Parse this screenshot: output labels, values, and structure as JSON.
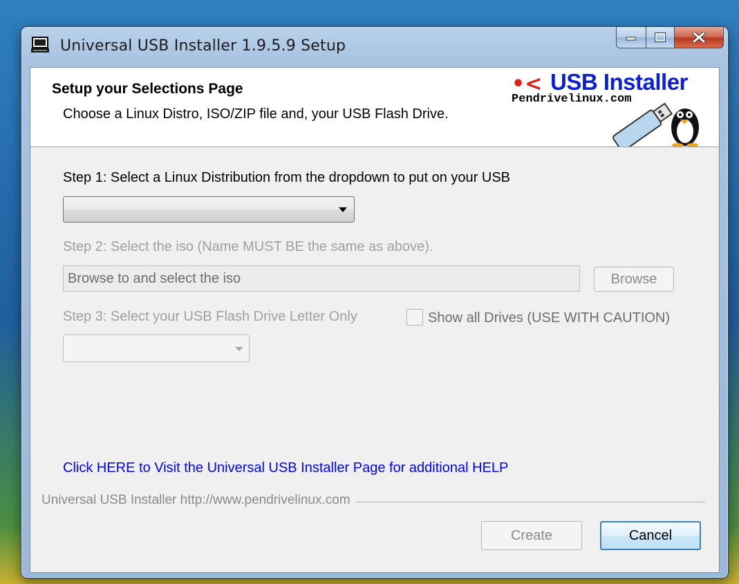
{
  "window": {
    "title": "Universal USB Installer 1.9.5.9 Setup"
  },
  "header": {
    "title": "Setup your Selections Page",
    "subtitle": "Choose a Linux Distro, ISO/ZIP file and, your USB Flash Drive.",
    "logo_title": "USB Installer",
    "logo_site": "Pendrivelinux.com"
  },
  "step1": {
    "label": "Step 1: Select a Linux Distribution from the dropdown to put on your USB",
    "selected_value": ""
  },
  "step2": {
    "label": "Step 2: Select the iso (Name MUST BE the same as above).",
    "field_value": "Browse to and select the iso",
    "browse_label": "Browse"
  },
  "step3": {
    "label": "Step 3: Select your USB Flash Drive Letter Only",
    "show_all_label": "Show all Drives (USE WITH CAUTION)",
    "selected_value": ""
  },
  "help_link": "Click HERE to Visit the Universal USB Installer Page for additional HELP",
  "branding": "Universal USB Installer http://www.pendrivelinux.com",
  "buttons": {
    "create": "Create",
    "cancel": "Cancel"
  }
}
